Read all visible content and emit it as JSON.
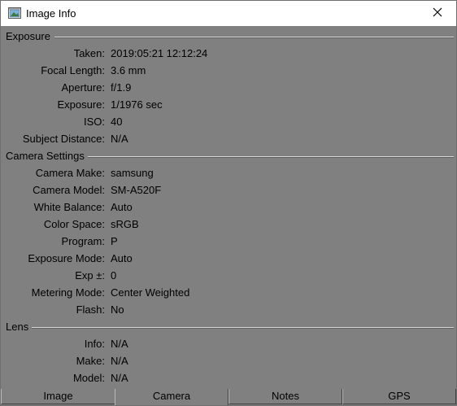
{
  "window": {
    "title": "Image Info"
  },
  "exposure": {
    "header": "Exposure",
    "rows": [
      {
        "label": "Taken:",
        "value": "2019:05:21 12:12:24"
      },
      {
        "label": "Focal Length:",
        "value": "3.6 mm"
      },
      {
        "label": "Aperture:",
        "value": "f/1.9"
      },
      {
        "label": "Exposure:",
        "value": "1/1976 sec"
      },
      {
        "label": "ISO:",
        "value": "40"
      },
      {
        "label": "Subject Distance:",
        "value": "N/A"
      }
    ]
  },
  "camera": {
    "header": "Camera Settings",
    "rows": [
      {
        "label": "Camera Make:",
        "value": "samsung"
      },
      {
        "label": "Camera Model:",
        "value": "SM-A520F"
      },
      {
        "label": "White Balance:",
        "value": "Auto"
      },
      {
        "label": "Color Space:",
        "value": "sRGB"
      },
      {
        "label": "Program:",
        "value": "P"
      },
      {
        "label": "Exposure Mode:",
        "value": "Auto"
      },
      {
        "label": "Exp ±:",
        "value": "0"
      },
      {
        "label": "Metering Mode:",
        "value": "Center Weighted"
      },
      {
        "label": "Flash:",
        "value": "No"
      }
    ]
  },
  "lens": {
    "header": "Lens",
    "rows": [
      {
        "label": "Info:",
        "value": "N/A"
      },
      {
        "label": "Make:",
        "value": "N/A"
      },
      {
        "label": "Model:",
        "value": "N/A"
      }
    ]
  },
  "tabs": [
    {
      "label": "Image",
      "active": false
    },
    {
      "label": "Camera",
      "active": true
    },
    {
      "label": "Notes",
      "active": false
    },
    {
      "label": "GPS",
      "active": false
    }
  ],
  "colors": {
    "panel": "#808080",
    "titlebar": "#ffffff",
    "text": "#000000"
  },
  "icons": {
    "app": "image-window-icon",
    "close": "close-icon"
  }
}
